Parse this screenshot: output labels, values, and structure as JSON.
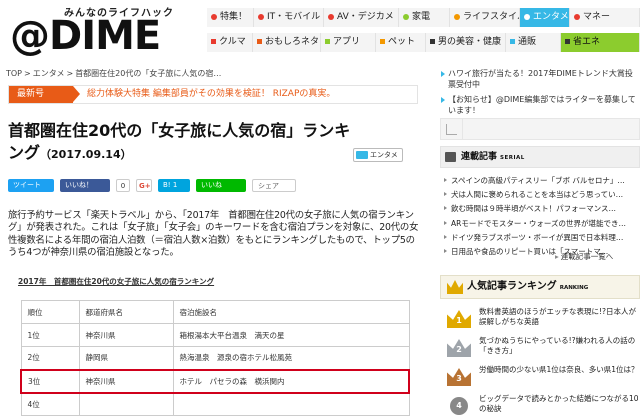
{
  "header": {
    "logo_tagline": "みんなのライフハック",
    "logo_text": "@DIME",
    "nav_row1": [
      {
        "label": "特集！",
        "color": "#e83a2e"
      },
      {
        "label": "IT・モバイル",
        "color": "#e83a2e"
      },
      {
        "label": "AV・デジカメ",
        "color": "#e83a2e"
      },
      {
        "label": "家電",
        "color": "#8ccc2e"
      },
      {
        "label": "ライフスタイル",
        "color": "#f39800"
      },
      {
        "label": "エンタメ",
        "color": "#36b8e6",
        "active": true
      },
      {
        "label": "マネー",
        "color": "#e83a2e"
      }
    ],
    "nav_row2": [
      {
        "label": "クルマ",
        "color": "#e83a2e"
      },
      {
        "label": "おもしろネタ",
        "color": "#e85b17"
      },
      {
        "label": "アプリ",
        "color": "#8ccc2e"
      },
      {
        "label": "ペット",
        "color": "#f39800"
      },
      {
        "label": "男の美容・健康",
        "color": "#333333"
      },
      {
        "label": "通販",
        "color": "#36b8e6"
      },
      {
        "label": "省エネ",
        "color": "#333333",
        "green": true
      }
    ]
  },
  "breadcrumb": [
    "TOP",
    ">",
    "エンタメ",
    ">",
    "首都圏在住20代の「女子旅に人気の宿…"
  ],
  "latest": {
    "badge": "最新号",
    "text": "総力体験大特集 編集部員がその効果を検証！ RIZAPの真実。"
  },
  "article": {
    "title": "首都圏在住20代の「女子旅に人気の宿」ランキング",
    "date": "（2017.09.14）",
    "category": "エンタメ",
    "body": "旅行予約サービス「楽天トラベル」から、「2017年　首都圏在住20代の女子旅に人気の宿ランキング」が発表された。これは「女子旅」「女子会」のキーワードを含む宿泊プランを対象に、20代の女性複数名による年間の宿泊人泊数（＝宿泊人数×泊数）をもとにランキングしたもので、トップ5のうち4つが神奈川県の宿泊施設となった。",
    "table_caption": "2017年　首都圏在住20代の女子旅に人気の宿ランキング",
    "table_header": [
      "順位",
      "都道府県名",
      "宿泊施設名"
    ],
    "table_rows": [
      [
        "1位",
        "神奈川県",
        "箱根湯本大平台温泉　満天の星"
      ],
      [
        "2位",
        "静岡県",
        "熱海温泉　源泉の宿ホテル松風苑"
      ],
      [
        "3位",
        "神奈川県",
        "ホテル　パセラの森　横浜関内"
      ],
      [
        "4位",
        "",
        ""
      ]
    ]
  },
  "share": {
    "tweet": "ツイート",
    "like": "いいね！",
    "like_count": "0",
    "gplus": "G+",
    "hatena": "B! 1",
    "line": "いいね",
    "save": "シェア"
  },
  "sidebar": {
    "promos": [
      "ハワイ旅行が当たる！2017年DIMEトレンド大賞投票受付中",
      "【お知らせ】@DIME編集部ではライターを募集しています！"
    ],
    "serial_title": "連載記事",
    "serial_en": "SERIAL",
    "serial_items": [
      "スペインの高級パティスリー「ブボ バルセロナ」…",
      "犬は人間に褒められることを本当はどう思ってい…",
      "飲む時間は９時半頃がベスト！パフォーマンス…",
      "ARモードでモスター・ウォーズの世界が堪能でき…",
      "ドイツ発ラブスポーツ・ボーイが異国で日本料理…",
      "日用品や食品のリピート買いは「スマートマ…"
    ],
    "serial_more": "連載記事一覧へ",
    "ranking_title": "人気記事ランキング",
    "ranking_en": "RANKING",
    "ranking": [
      {
        "rank": "1",
        "text": "数料書英語のほうがエッチな表現に!?日本人が誤解しがちな英語"
      },
      {
        "rank": "2",
        "text": "気づかぬうちにやっている!?嫌われる人の話の「きき方」"
      },
      {
        "rank": "3",
        "text": "労働時間の少ない県1位は奈良、多い県1位は？"
      },
      {
        "rank": "4",
        "text": "ビッグデータで読みとかった結婚につながる10の秘訣"
      }
    ]
  }
}
